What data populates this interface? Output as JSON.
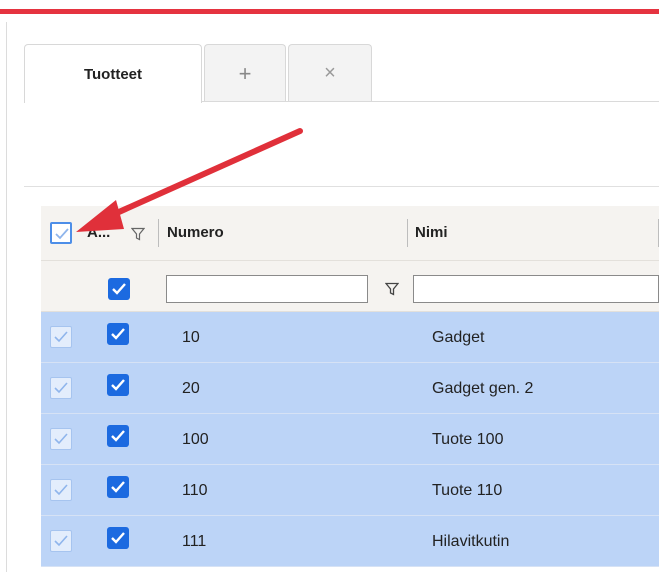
{
  "tabs": [
    {
      "label": "Tuotteet",
      "active": true
    },
    {
      "icon": "plus-icon",
      "glyph": "+"
    },
    {
      "icon": "close-icon",
      "glyph": "×"
    }
  ],
  "grid": {
    "columns": [
      {
        "label": "A..."
      },
      {
        "label": "Numero"
      },
      {
        "label": "Nimi"
      }
    ],
    "rows": [
      {
        "numero": "10",
        "nimi": "Gadget"
      },
      {
        "numero": "20",
        "nimi": "Gadget gen. 2"
      },
      {
        "numero": "100",
        "nimi": "Tuote 100"
      },
      {
        "numero": "110",
        "nimi": "Tuote 110"
      },
      {
        "numero": "111",
        "nimi": "Hilavitkutin"
      }
    ]
  },
  "colors": {
    "accent_red": "#e53340",
    "selected_row": "#bcd4f7",
    "checkbox_blue": "#1c6ae0",
    "arrow_red": "#e0303a"
  }
}
